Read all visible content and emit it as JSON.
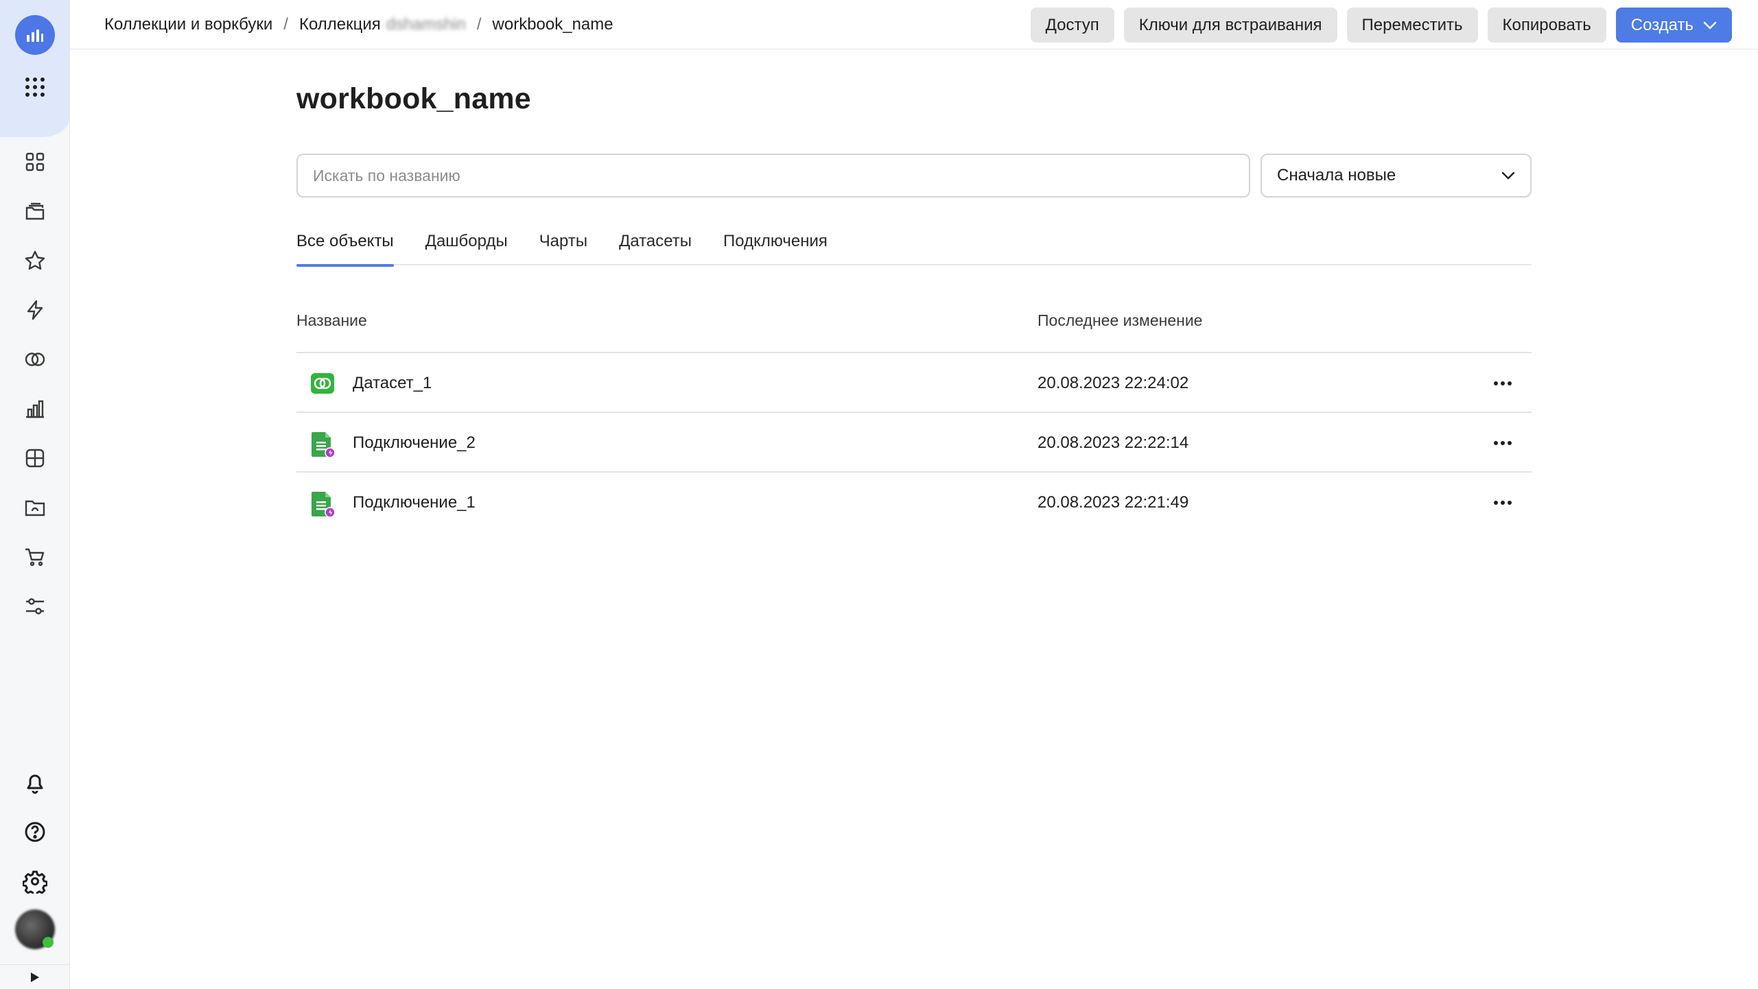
{
  "aside": {
    "logo_icon": "chart-logo-icon",
    "apps_icon": "apps-grid-icon",
    "nav": [
      {
        "name": "nav-collections-icon",
        "icon": "grid-icon"
      },
      {
        "name": "nav-workbooks-icon",
        "icon": "folders-icon"
      },
      {
        "name": "nav-favorites-icon",
        "icon": "star-icon"
      },
      {
        "name": "nav-connections-icon",
        "icon": "lightning-icon"
      },
      {
        "name": "nav-datasets-icon",
        "icon": "dataset-circles-icon"
      },
      {
        "name": "nav-charts-icon",
        "icon": "bar-chart-icon"
      },
      {
        "name": "nav-dashboards-icon",
        "icon": "dashboard-icon"
      },
      {
        "name": "nav-folder-icon",
        "icon": "folder-icon"
      },
      {
        "name": "nav-marketplace-icon",
        "icon": "cart-icon"
      },
      {
        "name": "nav-settings-sliders-icon",
        "icon": "sliders-icon"
      }
    ],
    "bottom": [
      "bell-icon",
      "help-icon",
      "gear-icon"
    ]
  },
  "header": {
    "breadcrumbs": {
      "root": "Коллекции и воркбуки",
      "collection_prefix": "Коллекция",
      "collection_name": "dshamshin",
      "current": "workbook_name",
      "separator": "/"
    },
    "actions": {
      "access": "Доступ",
      "embed_keys": "Ключи для встраивания",
      "move": "Переместить",
      "copy": "Копировать",
      "create": "Создать"
    }
  },
  "main": {
    "title": "workbook_name",
    "search": {
      "placeholder": "Искать по названию",
      "value": ""
    },
    "sort": {
      "selected": "Сначала новые"
    },
    "tabs": [
      "Все объекты",
      "Дашборды",
      "Чарты",
      "Датасеты",
      "Подключения"
    ],
    "active_tab": 0,
    "table": {
      "columns": {
        "name": "Название",
        "modified": "Последнее изменение"
      },
      "rows": [
        {
          "name": "Датасет_1",
          "modified": "20.08.2023 22:24:02",
          "type": "dataset"
        },
        {
          "name": "Подключение_2",
          "modified": "20.08.2023 22:22:14",
          "type": "connection"
        },
        {
          "name": "Подключение_1",
          "modified": "20.08.2023 22:21:49",
          "type": "connection"
        }
      ]
    }
  },
  "colors": {
    "accent": "#4d7ce6",
    "aside_bg": "#f6f7f8",
    "aside_top": "#dfe8fb",
    "dataset_green": "#31b53b",
    "connection_green": "#3aa64a",
    "connection_badge": "#b03cc8"
  }
}
